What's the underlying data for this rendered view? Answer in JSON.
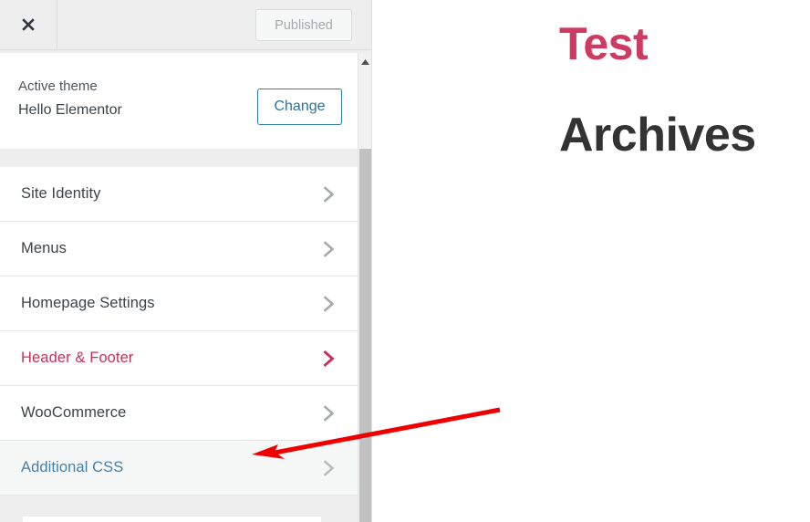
{
  "customizer": {
    "header": {
      "close_icon": "close-icon",
      "publish_label": "Published"
    },
    "theme": {
      "active_theme_label": "Active theme",
      "active_theme_name": "Hello Elementor",
      "change_label": "Change"
    },
    "sections": [
      {
        "label": "Site Identity",
        "chevron": "chevron-right-icon",
        "state": "normal"
      },
      {
        "label": "Menus",
        "chevron": "chevron-right-icon",
        "state": "normal"
      },
      {
        "label": "Homepage Settings",
        "chevron": "chevron-right-icon",
        "state": "normal"
      },
      {
        "label": "Header & Footer",
        "chevron": "chevron-right-icon",
        "state": "accent"
      },
      {
        "label": "WooCommerce",
        "chevron": "chevron-right-icon",
        "state": "normal"
      },
      {
        "label": "Additional CSS",
        "chevron": "chevron-right-icon",
        "state": "hovered"
      }
    ],
    "scrollbar": {
      "up_arrow_icon": "scroll-up-arrow-icon",
      "thumb": "scrollbar-thumb"
    }
  },
  "preview": {
    "title": "Test",
    "subtitle": "Archives"
  },
  "annotation": {
    "arrow_icon": "red-arrow-annotation",
    "color": "#ee0000"
  },
  "colors": {
    "accent_pink": "#c6315b",
    "preview_title_pink": "#cd3a62",
    "link_blue": "#2c71a0",
    "hover_blue": "#4a7fa6",
    "panel_bg": "#eeeeee",
    "row_bg": "#ffffff",
    "row_hover_bg": "#f6f7f7",
    "text_dark": "#3c434a",
    "scrollbar_thumb": "#c1c1c1",
    "annotation_red": "#ee0000"
  }
}
